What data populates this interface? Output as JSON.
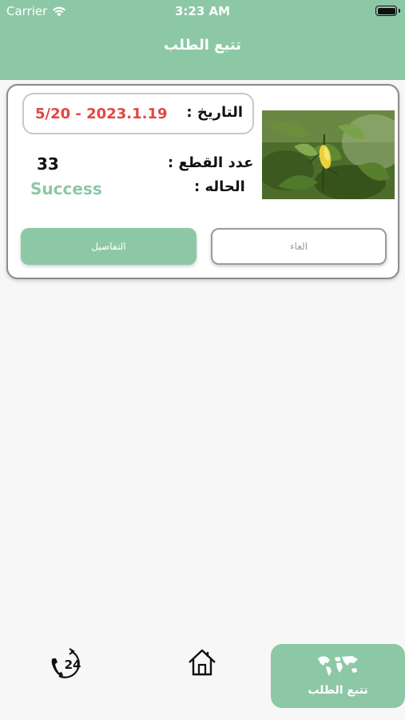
{
  "status_bar": {
    "carrier": "Carrier",
    "time": "3:23 AM"
  },
  "header": {
    "title": "تتبع الطلب"
  },
  "order": {
    "date_label": "التاريخ :",
    "date_value": "5/20 - 2023.1.19",
    "quantity_label": "عدد القطع :",
    "quantity_value": "33",
    "status_label": "الحاله :",
    "status_value": "Success",
    "status_color": "#8cc8a5",
    "date_color": "#e2473d",
    "image_subject": "lemon tree branch with yellow lemon",
    "details_button": "التفاصيل",
    "cancel_button": "الغاء"
  },
  "tabbar": {
    "support_icon": "phone-24-icon",
    "home_icon": "home-icon",
    "track_label": "تتبع الطلب",
    "track_icon": "world-map-icon"
  },
  "colors": {
    "accent": "#8cc8a5",
    "background": "#f7f7f7"
  }
}
